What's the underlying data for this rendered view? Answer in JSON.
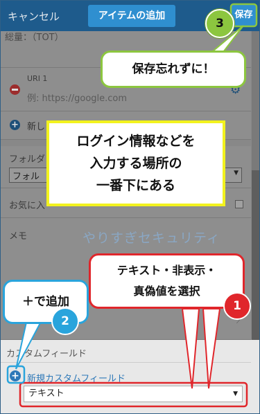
{
  "header": {
    "cancel": "キャンセル",
    "title": "アイテムの追加",
    "save": "保存"
  },
  "top_cut": {
    "text": "総量：（TOT）"
  },
  "uri": {
    "label": "URI 1",
    "placeholder": "例: https://google.com"
  },
  "new_uri": {
    "label": "新し"
  },
  "folder": {
    "label": "フォルダ",
    "value": "フォル"
  },
  "favorite": {
    "label": "お気に入"
  },
  "memo": {
    "label": "メモ"
  },
  "watermark": "やりすぎセキュリティ",
  "custom_fields": {
    "title": "カスタムフィールド",
    "add_label": "新規カスタムフィールド",
    "type_value": "テキスト"
  },
  "annotations": {
    "save_reminder": "保存忘れずに！",
    "login_info": [
      "ログイン情報などを",
      "入力する場所の",
      "一番下にある"
    ],
    "select_type": [
      "テキスト・非表示・",
      "真偽値を選択"
    ],
    "add_with_plus": "＋で追加",
    "badge1": "1",
    "badge2": "2",
    "badge3": "3"
  },
  "colors": {
    "header": "#1e5b8c",
    "accent": "#2f8fd0",
    "green_badge": "#8cc63f",
    "red_badge": "#e0262b",
    "blue_badge": "#29a4dc",
    "yellow_border": "#f2f21e"
  }
}
